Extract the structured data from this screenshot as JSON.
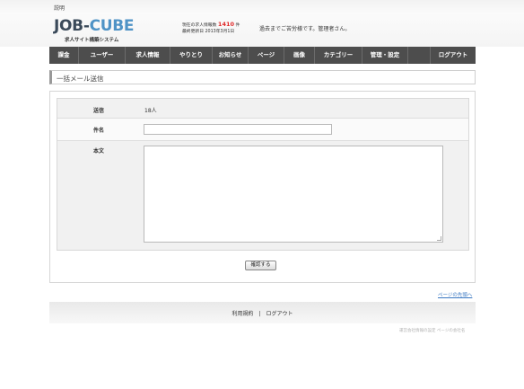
{
  "topbar": {
    "label": "説明"
  },
  "header": {
    "logo_main": "JOB-",
    "logo_accent": "CUBE",
    "logo_sub": "求人サイト構築システム",
    "stats_prefix": "現在の求人情報数",
    "stats_count": "1410",
    "stats_unit": "件",
    "updated": "最終更新日 2013年3月1日",
    "welcome": "過去までご苦労様です。管理者さん。"
  },
  "nav": [
    {
      "label": "課金",
      "name": "nav-billing"
    },
    {
      "label": "ユーザー",
      "name": "nav-users"
    },
    {
      "label": "求人情報",
      "name": "nav-job-info"
    },
    {
      "label": "やりとり",
      "name": "nav-messages"
    },
    {
      "label": "お知らせ",
      "name": "nav-news"
    },
    {
      "label": "ページ",
      "name": "nav-pages"
    },
    {
      "label": "画像",
      "name": "nav-images"
    },
    {
      "label": "カテゴリー",
      "name": "nav-categories"
    },
    {
      "label": "管理・設定",
      "name": "nav-settings"
    },
    {
      "label": "",
      "name": "nav-blank"
    },
    {
      "label": "ログアウト",
      "name": "nav-logout"
    }
  ],
  "page": {
    "title": "一括メール送信"
  },
  "form": {
    "send_label": "送信",
    "send_value": "18人",
    "subject_label": "件名",
    "subject_value": "",
    "body_label": "本文",
    "body_value": "",
    "confirm_button": "確認する"
  },
  "to_top": "ページの先頭へ",
  "footer": {
    "terms": "利用規約",
    "separator": "|",
    "logout": "ログアウト",
    "copyright": "運営会社情報の設定 ページの会社名"
  }
}
